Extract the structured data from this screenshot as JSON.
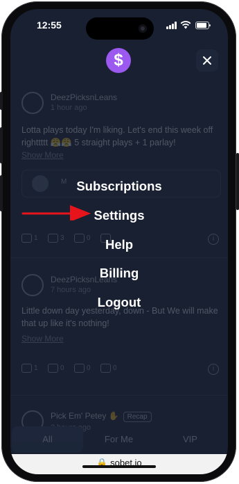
{
  "status_bar": {
    "time": "12:55",
    "battery_level": 0.85
  },
  "header": {
    "logo_symbol": "$",
    "logo_color": "#9b59f0",
    "close_symbol": "✕"
  },
  "feed": {
    "posts": [
      {
        "username": "DeezPicksnLeans",
        "time": "1 hour ago",
        "text": "Lotta plays today I'm liking. Let's end this week off righttttt 😤😤 5 straight plays + 1 parlay!",
        "show_more": "Show More",
        "embed_name": "M",
        "embed_tag": "",
        "actions": [
          "1",
          "3",
          "0",
          ""
        ]
      },
      {
        "username": "DeezPicksnLeans",
        "time": "7 hours ago",
        "text": "Little down day yesterday, down - But We will make that up like it's nothing!",
        "show_more": "Show More",
        "actions": [
          "1",
          "0",
          "0",
          "0"
        ]
      },
      {
        "username": "Pick Em' Petey ✋",
        "badge": "Recap",
        "time": "3 hours ago"
      }
    ],
    "tabs": [
      "All",
      "For Me",
      "VIP"
    ]
  },
  "menu": {
    "items": [
      "Subscriptions",
      "Settings",
      "Help",
      "Billing",
      "Logout"
    ],
    "arrow_color": "#e8141b",
    "arrow_target": "Settings"
  },
  "browser": {
    "url": "🔒 sobet.io"
  }
}
